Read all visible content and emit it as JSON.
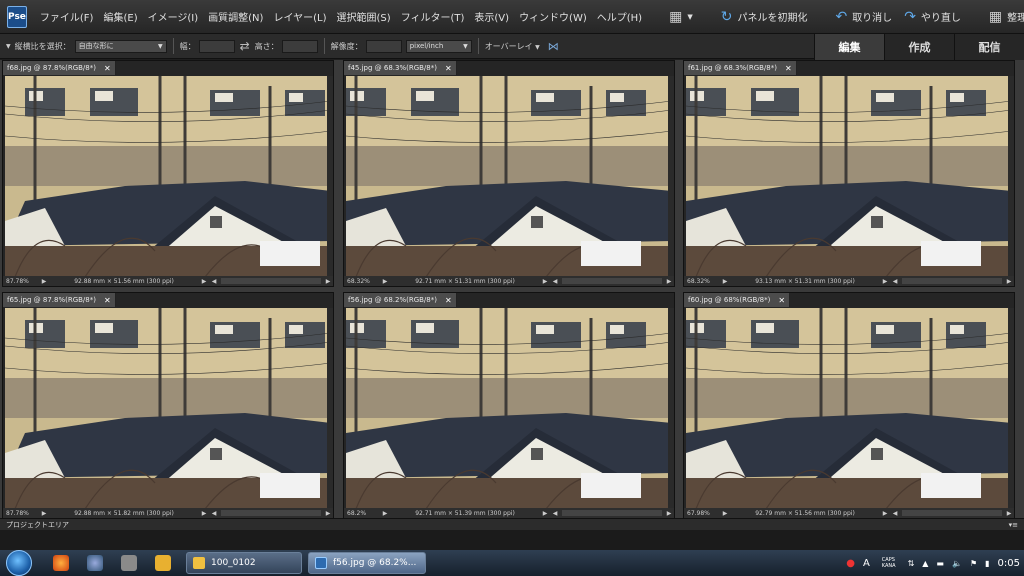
{
  "menubar": {
    "items": [
      "ファイル(F)",
      "編集(E)",
      "イメージ(I)",
      "画質調整(N)",
      "レイヤー(L)",
      "選択範囲(S)",
      "フィルター(T)",
      "表示(V)",
      "ウィンドウ(W)",
      "ヘルプ(H)"
    ],
    "reset_panels": "パネルを初期化",
    "undo": "取り消し",
    "redo": "やり直し",
    "organize": "整理"
  },
  "options": {
    "aspect_label": "縦横比を選択：",
    "aspect_value": "自由な形に",
    "width_label": "幅：",
    "height_label": "高さ：",
    "resolution_label": "解像度：",
    "unit_value": "pixel/inch",
    "overlay_label": "オーバーレイ"
  },
  "mode_tabs": [
    "編集",
    "作成",
    "配信"
  ],
  "documents": [
    {
      "tab": "f68.jpg @ 87.8%(RGB/8*)",
      "zoom": "87.78%",
      "dims": "92.88 mm × 51.56 mm (300 ppi)"
    },
    {
      "tab": "f45.jpg @ 68.3%(RGB/8*)",
      "zoom": "68.32%",
      "dims": "92.71 mm × 51.31 mm (300 ppi)"
    },
    {
      "tab": "f61.jpg @ 68.3%(RGB/8*)",
      "zoom": "68.32%",
      "dims": "93.13 mm × 51.31 mm (300 ppi)"
    },
    {
      "tab": "f65.jpg @ 87.8%(RGB/8*)",
      "zoom": "87.78%",
      "dims": "92.88 mm × 51.82 mm (300 ppi)"
    },
    {
      "tab": "f56.jpg @ 68.2%(RGB/8*)",
      "zoom": "68.2%",
      "dims": "92.71 mm × 51.39 mm (300 ppi)"
    },
    {
      "tab": "f60.jpg @ 68%(RGB/8*)",
      "zoom": "67.98%",
      "dims": "92.79 mm × 51.56 mm (300 ppi)"
    }
  ],
  "project_bin": "プロジェクトエリア",
  "taskbar": {
    "task1": "100_0102",
    "task2": "f56.jpg @ 68.2%...",
    "ime_caps": "CAPS",
    "ime_kana": "KANA",
    "clock": "0:05"
  }
}
